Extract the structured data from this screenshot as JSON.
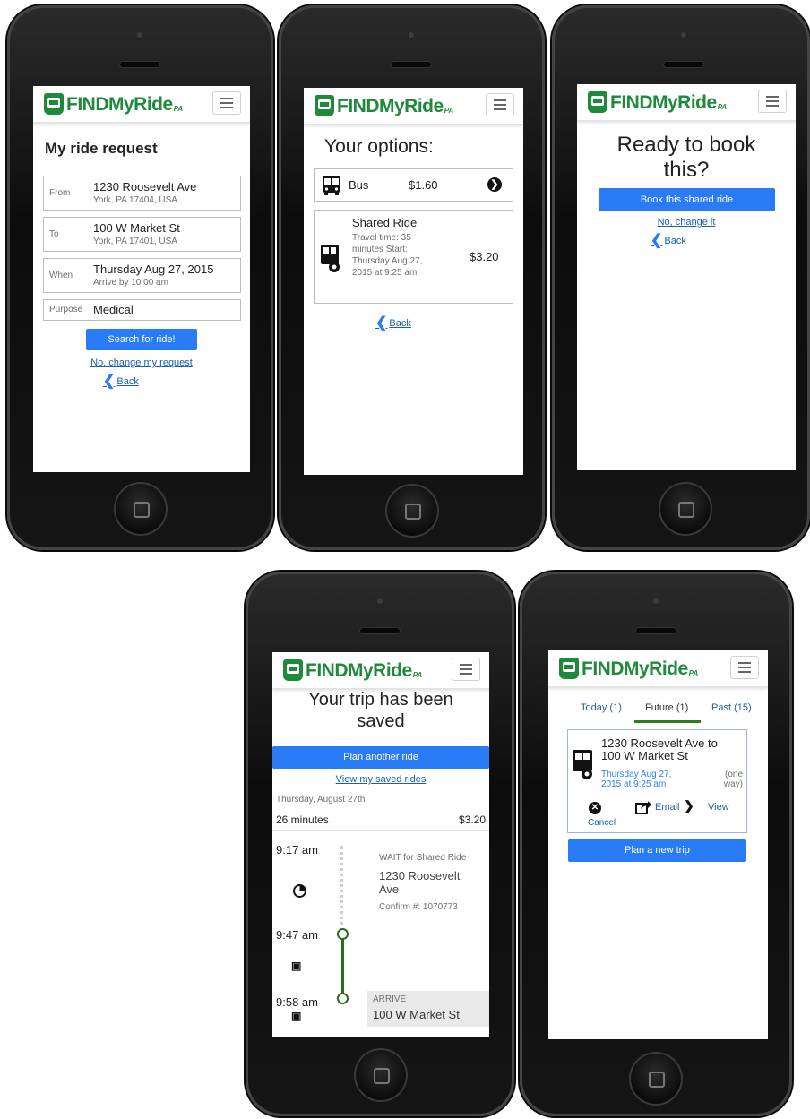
{
  "brand": {
    "find": "FIND",
    "myride": "MyRide",
    "pa": "PA"
  },
  "screen1": {
    "title": "My ride request",
    "from_label": "From",
    "from_main": "1230 Roosevelt Ave",
    "from_sub": "York, PA 17404, USA",
    "to_label": "To",
    "to_main": "100 W Market St",
    "to_sub": "York, PA 17401, USA",
    "when_label": "When",
    "when_main": "Thursday Aug 27, 2015",
    "when_sub": "Arrive by 10:00 am",
    "purpose_label": "Purpose",
    "purpose_value": "Medical",
    "search_button": "Search for ride!",
    "change_link": "No, change my request",
    "back": "Back"
  },
  "screen2": {
    "title": "Your options:",
    "bus_label": "Bus",
    "bus_price": "$1.60",
    "shared_title": "Shared Ride",
    "shared_desc": "Travel time: 35 minutes Start: Thursday Aug 27, 2015 at 9:25 am",
    "shared_price": "$3.20",
    "back": "Back"
  },
  "screen3": {
    "title": "Ready to book this?",
    "book_button": "Book this shared ride",
    "change_link": "No, change it",
    "back": "Back"
  },
  "screen4": {
    "title": "Your trip has been saved",
    "plan_button": "Plan another ride",
    "view_link": "View my saved rides",
    "date": "Thursday, August 27th",
    "duration": "26 minutes",
    "price": "$3.20",
    "time1": "9:17 am",
    "time2": "9:47 am",
    "time3": "9:58 am",
    "wait_label": "WAIT for Shared Ride",
    "wait_place": "1230 Roosevelt Ave",
    "confirm": "Confirm #: 1070773",
    "arrive_label": "ARRIVE",
    "arrive_place": "100 W Market St"
  },
  "screen5": {
    "tab_today": "Today (1)",
    "tab_future": "Future (1)",
    "tab_past": "Past (15)",
    "trip_title": "1230 Roosevelt Ave to 100 W Market St",
    "trip_time": "Thursday Aug 27, 2015 at 9:25 am",
    "trip_type": "(one way)",
    "cancel": "Cancel",
    "email": "Email",
    "view": "View",
    "plan_button": "Plan a new trip"
  },
  "colors": {
    "brand_green": "#1f8a3c",
    "primary_blue": "#2a7cf6",
    "link_blue": "#1a5fb4",
    "tab_underline": "#2e7d1a"
  },
  "icons": [
    "menu-icon",
    "bus-icon",
    "shared-ride-icon",
    "chevron-right-circle-icon",
    "chevron-left-icon",
    "clock-icon",
    "cancel-icon",
    "share-icon",
    "chevron-right-icon"
  ]
}
